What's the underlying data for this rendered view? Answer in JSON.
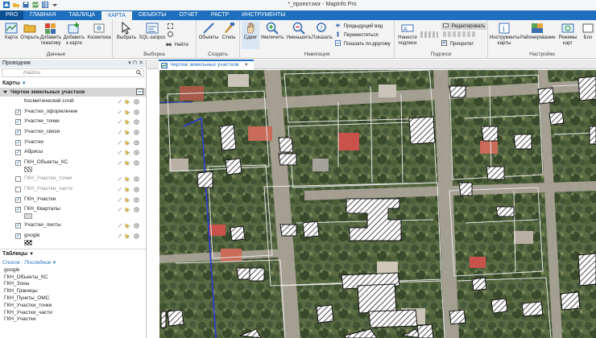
{
  "window": {
    "title": "*_проект.wor - MapInfo Pro"
  },
  "ribbon_tabs": [
    "PRO",
    "ГЛАВНАЯ",
    "ТАБЛИЦА",
    "КАРТА",
    "ОБЪЕКТЫ",
    "ОТЧЕТ",
    "РАСТР",
    "ИНСТРУМЕНТЫ"
  ],
  "ribbon": {
    "data_group": {
      "title": "Данные",
      "map": "Карта",
      "open": "Открыть",
      "add_theme": "Добавить тематику",
      "add_to_map": "Добавить к карте",
      "cosmetic": "Косметика"
    },
    "select_group": {
      "title": "Выборка",
      "select": "Выбрать",
      "sql": "SQL-запрос",
      "find": "Найти"
    },
    "create_group": {
      "title": "Создать",
      "objects": "Объекты",
      "style": "Стиль"
    },
    "nav_group": {
      "title": "Навигация",
      "pan": "Сдвиг",
      "zoom_in": "Увеличить",
      "zoom_out": "Уменьшить",
      "show": "Показать",
      "prev_view": "Предыдущий вид",
      "move": "Переместиться",
      "show_by_other": "Показать по-другому"
    },
    "labels_group": {
      "title": "Подписи",
      "apply_labels": "Нанести подписи",
      "edit": "Редактировать",
      "priority": "Приоритет"
    },
    "settings_group": {
      "title": "Настройки",
      "map_tools": "Инструменты карты",
      "zoning": "Районирование",
      "map_modes": "Режимы карт",
      "block": "Бло"
    }
  },
  "explorer": {
    "title": "Проводник",
    "search_placeholder": "Найти",
    "maps_section": "Карты",
    "map_window": "Чертеж земельных участков",
    "layers": [
      {
        "name": "Косметический слой",
        "checked": null
      },
      {
        "name": "Участки_оформление",
        "checked": true
      },
      {
        "name": "Участки_точки",
        "checked": true
      },
      {
        "name": "Участки_связи",
        "checked": true
      },
      {
        "name": "Участки",
        "checked": true
      },
      {
        "name": "Абрисы",
        "checked": true
      },
      {
        "name": "ГКН_Объекты_КС",
        "checked": true
      },
      {
        "name": "ГКН_Участки_точки",
        "checked": false
      },
      {
        "name": "ГКН_Участки_части",
        "checked": false
      },
      {
        "name": "ГКН_Участки",
        "checked": true
      },
      {
        "name": "ГКН_Кварталы",
        "checked": true
      },
      {
        "name": "Участки_листы",
        "checked": true
      },
      {
        "name": "google",
        "checked": true
      }
    ],
    "tables_section": "Таблицы",
    "tables_list_label": "Список : Последние",
    "tables": [
      "google",
      "ГКН_Объекты_КС",
      "ГКН_Зоны",
      "ГКН_Границы",
      "ГКН_Пункты_ОМС",
      "ГКН_Участки_точки",
      "ГКН_Участки_части",
      "ГКН_Участки"
    ]
  },
  "document_tab": {
    "title": "Чертеж земельных участков"
  },
  "colors": {
    "accent": "#1e6fbd",
    "tab_bar": "#1e6fbd",
    "ribbon_bg": "#f3f3f3"
  }
}
